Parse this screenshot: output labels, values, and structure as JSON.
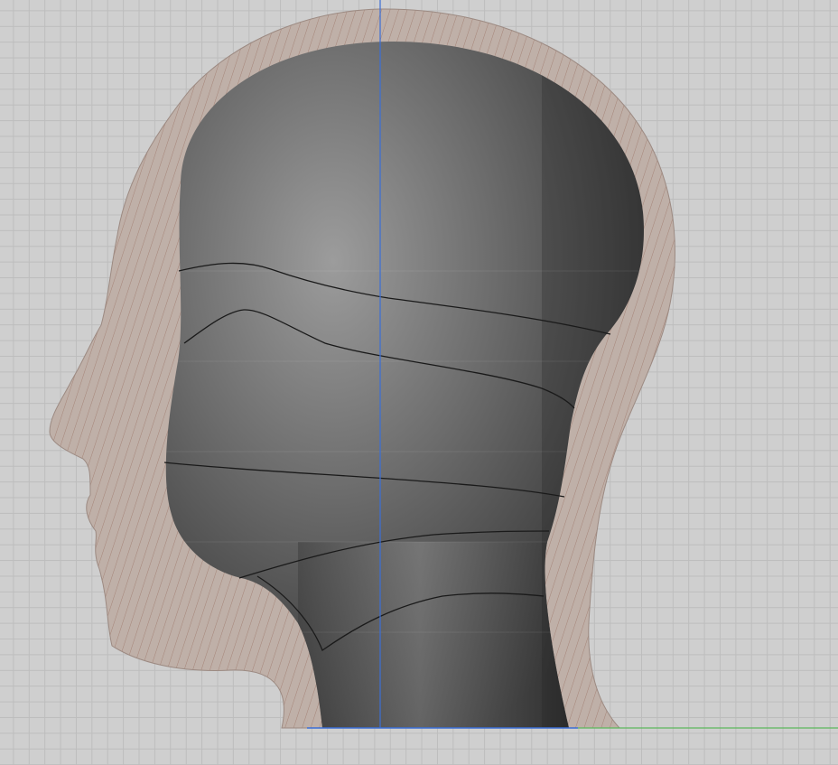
{
  "viewport": {
    "background": "#cfcfcf",
    "grid_color": "#bdbdbd",
    "view": "side-section",
    "grid_visible": true
  },
  "model": {
    "object": "head-bust",
    "section_fill_color": "#bfb0a8",
    "hatch_color": "#a07c70",
    "surface_shade_dark": "#2e2e2e",
    "surface_shade_light": "#9a9a9a",
    "surface_edge_color": "#1a1a1a",
    "surface_curve_count": 5
  },
  "guides": {
    "vertical_axis_color": "#3b6fd6",
    "ground_axis_color": "#3b6fd6",
    "ground_extension_color": "#5cb85c"
  }
}
